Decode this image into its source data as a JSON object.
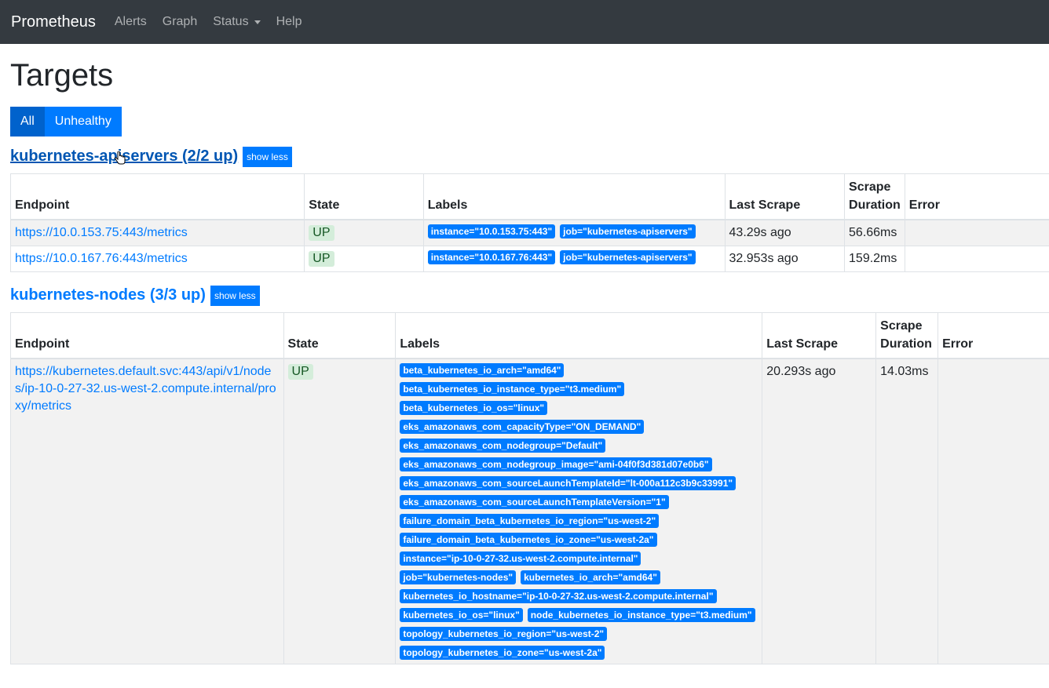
{
  "navbar": {
    "brand": "Prometheus",
    "links": [
      "Alerts",
      "Graph",
      "Status",
      "Help"
    ]
  },
  "page": {
    "title": "Targets",
    "filters": {
      "all": "All",
      "unhealthy": "Unhealthy"
    },
    "show_less": "show less"
  },
  "columns": {
    "endpoint": "Endpoint",
    "state": "State",
    "labels": "Labels",
    "last_scrape": "Last Scrape",
    "scrape_duration": "Scrape Duration",
    "error": "Error"
  },
  "pools": [
    {
      "title": "kubernetes-apiservers (2/2 up)",
      "targets": [
        {
          "endpoint": "https://10.0.153.75:443/metrics",
          "state": "UP",
          "labels": [
            "instance=\"10.0.153.75:443\"",
            "job=\"kubernetes-apiservers\""
          ],
          "last_scrape": "43.29s ago",
          "duration": "56.66ms",
          "error": ""
        },
        {
          "endpoint": "https://10.0.167.76:443/metrics",
          "state": "UP",
          "labels": [
            "instance=\"10.0.167.76:443\"",
            "job=\"kubernetes-apiservers\""
          ],
          "last_scrape": "32.953s ago",
          "duration": "159.2ms",
          "error": ""
        }
      ]
    },
    {
      "title": "kubernetes-nodes (3/3 up)",
      "targets": [
        {
          "endpoint": "https://kubernetes.default.svc:443/api/v1/nodes/ip-10-0-27-32.us-west-2.compute.internal/proxy/metrics",
          "state": "UP",
          "labels": [
            "beta_kubernetes_io_arch=\"amd64\"",
            "beta_kubernetes_io_instance_type=\"t3.medium\"",
            "beta_kubernetes_io_os=\"linux\"",
            "eks_amazonaws_com_capacityType=\"ON_DEMAND\"",
            "eks_amazonaws_com_nodegroup=\"Default\"",
            "eks_amazonaws_com_nodegroup_image=\"ami-04f0f3d381d07e0b6\"",
            "eks_amazonaws_com_sourceLaunchTemplateId=\"lt-000a112c3b9c33991\"",
            "eks_amazonaws_com_sourceLaunchTemplateVersion=\"1\"",
            "failure_domain_beta_kubernetes_io_region=\"us-west-2\"",
            "failure_domain_beta_kubernetes_io_zone=\"us-west-2a\"",
            "instance=\"ip-10-0-27-32.us-west-2.compute.internal\"",
            "job=\"kubernetes-nodes\"",
            "kubernetes_io_arch=\"amd64\"",
            "kubernetes_io_hostname=\"ip-10-0-27-32.us-west-2.compute.internal\"",
            "kubernetes_io_os=\"linux\"",
            "node_kubernetes_io_instance_type=\"t3.medium\"",
            "topology_kubernetes_io_region=\"us-west-2\"",
            "topology_kubernetes_io_zone=\"us-west-2a\""
          ],
          "last_scrape": "20.293s ago",
          "duration": "14.03ms",
          "error": ""
        }
      ]
    }
  ]
}
